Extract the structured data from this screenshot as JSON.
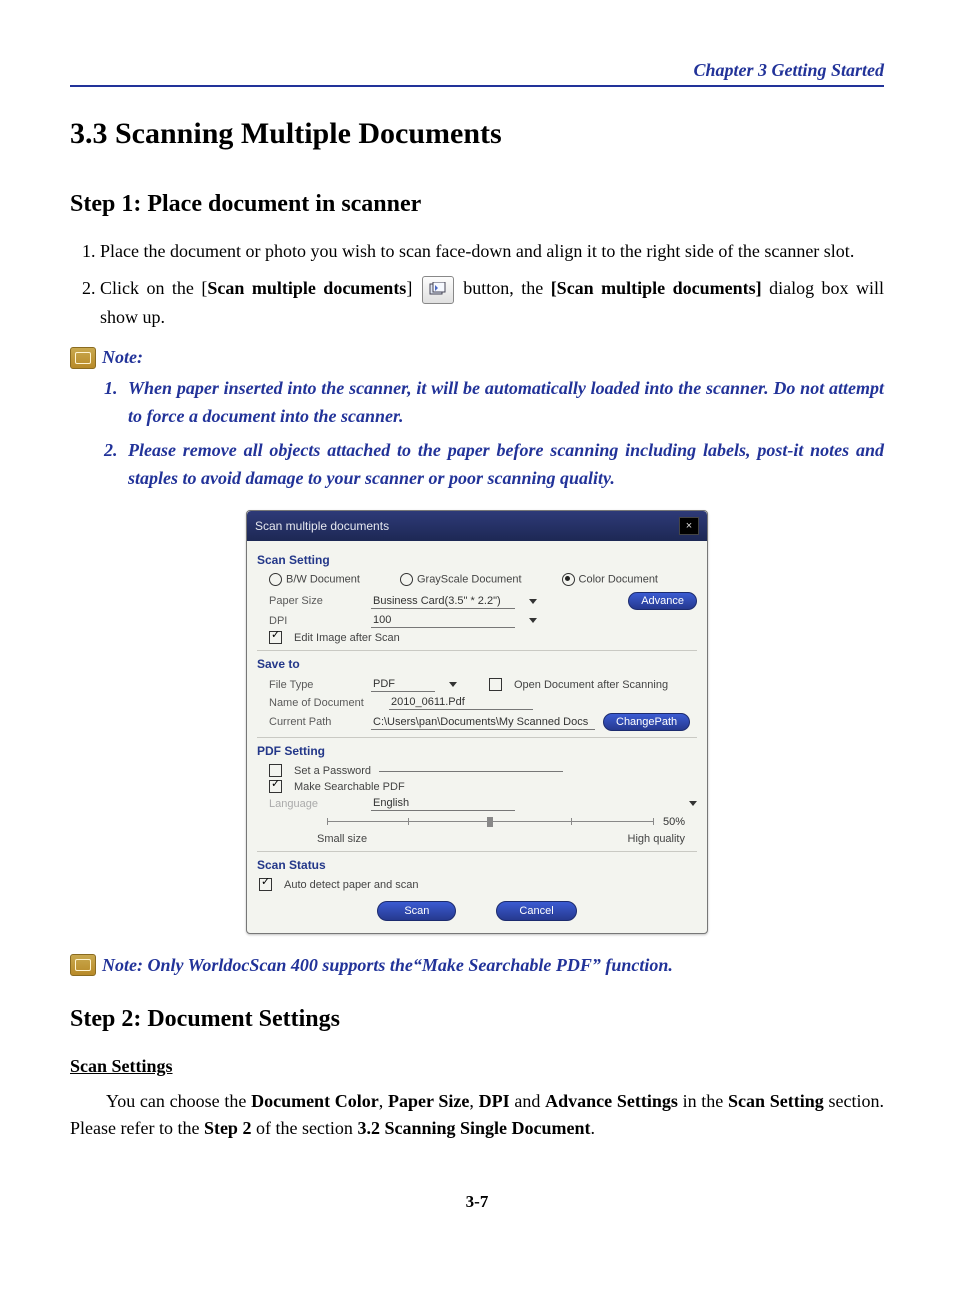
{
  "chapter_header": "Chapter 3   Getting Started",
  "section_title": "3.3 Scanning Multiple Documents",
  "step1_title": "Step 1: Place document in scanner",
  "instr1": "Place the document or photo you wish to scan face-down and align it to the right side of the scanner slot.",
  "instr2_a": "Click on the [",
  "instr2_b": "Scan multiple documents",
  "instr2_c": "] ",
  "instr2_d": " button, the ",
  "instr2_e": "[Scan multiple documents]",
  "instr2_f": " dialog box will show up.",
  "note_label": "Note:",
  "note1": "When paper inserted into the scanner, it will be automatically loaded into the scanner. Do not attempt to force a document into the scanner.",
  "note2": "Please remove all objects attached to the paper before scanning including labels, post-it notes and staples to avoid damage to your scanner or poor scanning quality.",
  "note_after_dialog": "Note: Only WorldocScan 400 supports the“Make Searchable PDF” function.",
  "step2_title": "Step 2: Document Settings",
  "scan_settings_heading": "Scan Settings",
  "step2_para_a": "You can choose the ",
  "step2_para_b": "Document Color",
  "step2_para_c": ", ",
  "step2_para_d": "Paper Size",
  "step2_para_e": ", ",
  "step2_para_f": "DPI",
  "step2_para_g": " and ",
  "step2_para_h": "Advance Settings",
  "step2_para_i": " in the ",
  "step2_para_j": "Scan Setting",
  "step2_para_k": " section. Please refer to the ",
  "step2_para_l": "Step 2",
  "step2_para_m": " of the section ",
  "step2_para_n": "3.2 Scanning Single Document",
  "step2_para_o": ".",
  "page_number": "3-7",
  "dialog": {
    "title": "Scan multiple documents",
    "scan_setting": {
      "heading": "Scan Setting",
      "radio_bw": "B/W Document",
      "radio_gray": "GrayScale Document",
      "radio_color": "Color Document",
      "selected_radio": "color",
      "paper_size_label": "Paper Size",
      "paper_size_value": "Business Card(3.5\" * 2.2\")",
      "dpi_label": "DPI",
      "dpi_value": "100",
      "advance_btn": "Advance",
      "edit_after_scan_label": "Edit Image after Scan",
      "edit_after_scan_checked": true
    },
    "save_to": {
      "heading": "Save to",
      "file_type_label": "File Type",
      "file_type_value": "PDF",
      "open_after_label": "Open Document after Scanning",
      "open_after_checked": false,
      "name_label": "Name of Document",
      "name_value": "2010_0611.Pdf",
      "path_label": "Current Path",
      "path_value": "C:\\Users\\pan\\Documents\\My Scanned Docs",
      "change_path_btn": "ChangePath"
    },
    "pdf_setting": {
      "heading": "PDF Setting",
      "password_label": "Set a Password",
      "password_checked": false,
      "searchable_label": "Make Searchable PDF",
      "searchable_checked": true,
      "language_label": "Language",
      "language_value": "English",
      "slider_percent": "50%",
      "slider_left": "Small size",
      "slider_right": "High quality"
    },
    "scan_status": {
      "heading": "Scan Status",
      "auto_detect_label": "Auto detect paper and scan",
      "auto_detect_checked": true
    },
    "buttons": {
      "scan": "Scan",
      "cancel": "Cancel"
    }
  }
}
